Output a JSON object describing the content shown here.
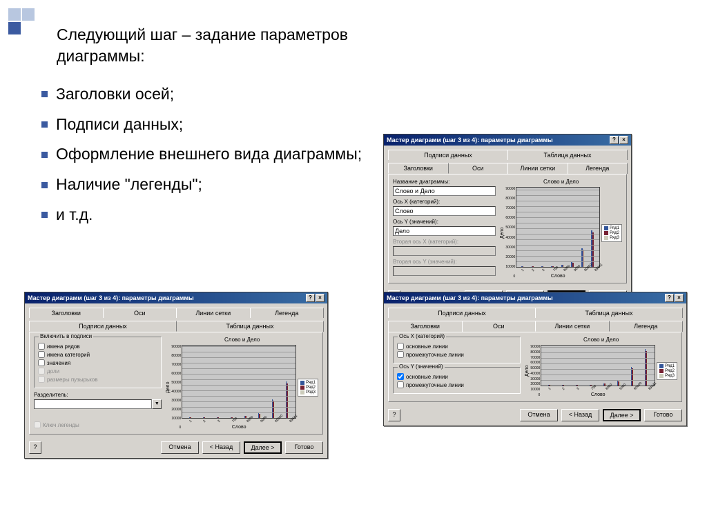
{
  "text": {
    "heading": "Следующий шаг – задание параметров диаграммы:",
    "items": [
      "Заголовки осей;",
      "Подписи данных;",
      "Оформление внешнего вида диаграммы;",
      "Наличие \"легенды\";",
      " и т.д."
    ]
  },
  "dialog_common": {
    "title": "Мастер диаграмм (шаг 3 из 4): параметры диаграммы",
    "tabs": {
      "titles": "Заголовки",
      "axes": "Оси",
      "gridlines": "Линии сетки",
      "legend": "Легенда",
      "data_labels": "Подписи данных",
      "data_table": "Таблица данных"
    },
    "buttons": {
      "cancel": "Отмена",
      "back": "< Назад",
      "next": "Далее >",
      "ready": "Готово",
      "help": "?",
      "close": "×"
    },
    "preview": {
      "title": "Слово и Дело",
      "ylabel": "Дело",
      "xlabel": "Слово",
      "legend": [
        "Ряд1",
        "Ряд2",
        "Ряд3"
      ]
    }
  },
  "dlg1": {
    "fields": {
      "chart_title_label": "Название диаграммы:",
      "chart_title_value": "Слово и Дело",
      "x_label": "Ось X (категорий):",
      "x_value": "Слово",
      "y_label": "Ось Y (значений):",
      "y_value": "Дело",
      "x2_label": "Вторая ось X (категорий):",
      "y2_label": "Вторая ось Y (значений):"
    }
  },
  "dlg2": {
    "group_title": "Включить в подписи",
    "checks": {
      "series_names": "имена рядов",
      "category_names": "имена категорий",
      "values": "значения",
      "percentages": "доли",
      "bubble_sizes": "размеры пузырьков"
    },
    "sep_label": "Разделитель:",
    "legend_key": "Ключ легенды"
  },
  "dlg3": {
    "x_group": "Ось X (категорий)",
    "y_group": "Ось Y (значений)",
    "main_lines": "основные линии",
    "inter_lines": "промежуточные линии"
  },
  "chart_data": {
    "type": "bar",
    "title": "Слово и Дело",
    "xlabel": "Слово",
    "ylabel": "Дело",
    "categories": [
      "1",
      "2",
      "3",
      "790",
      "8000",
      "9000",
      "80000",
      "89441"
    ],
    "series": [
      {
        "name": "Ряд1",
        "values": [
          100,
          200,
          300,
          700,
          5000,
          10000,
          40000,
          80000
        ]
      },
      {
        "name": "Ряд2",
        "values": [
          80,
          150,
          250,
          600,
          4000,
          9000,
          38000,
          75000
        ]
      },
      {
        "name": "Ряд3",
        "values": [
          60,
          100,
          200,
          500,
          3000,
          7000,
          35000,
          70000
        ]
      }
    ],
    "ylim": [
      0,
      90000
    ],
    "yticks": [
      90000,
      80000,
      70000,
      60000,
      50000,
      40000,
      30000,
      20000,
      10000,
      0
    ]
  }
}
